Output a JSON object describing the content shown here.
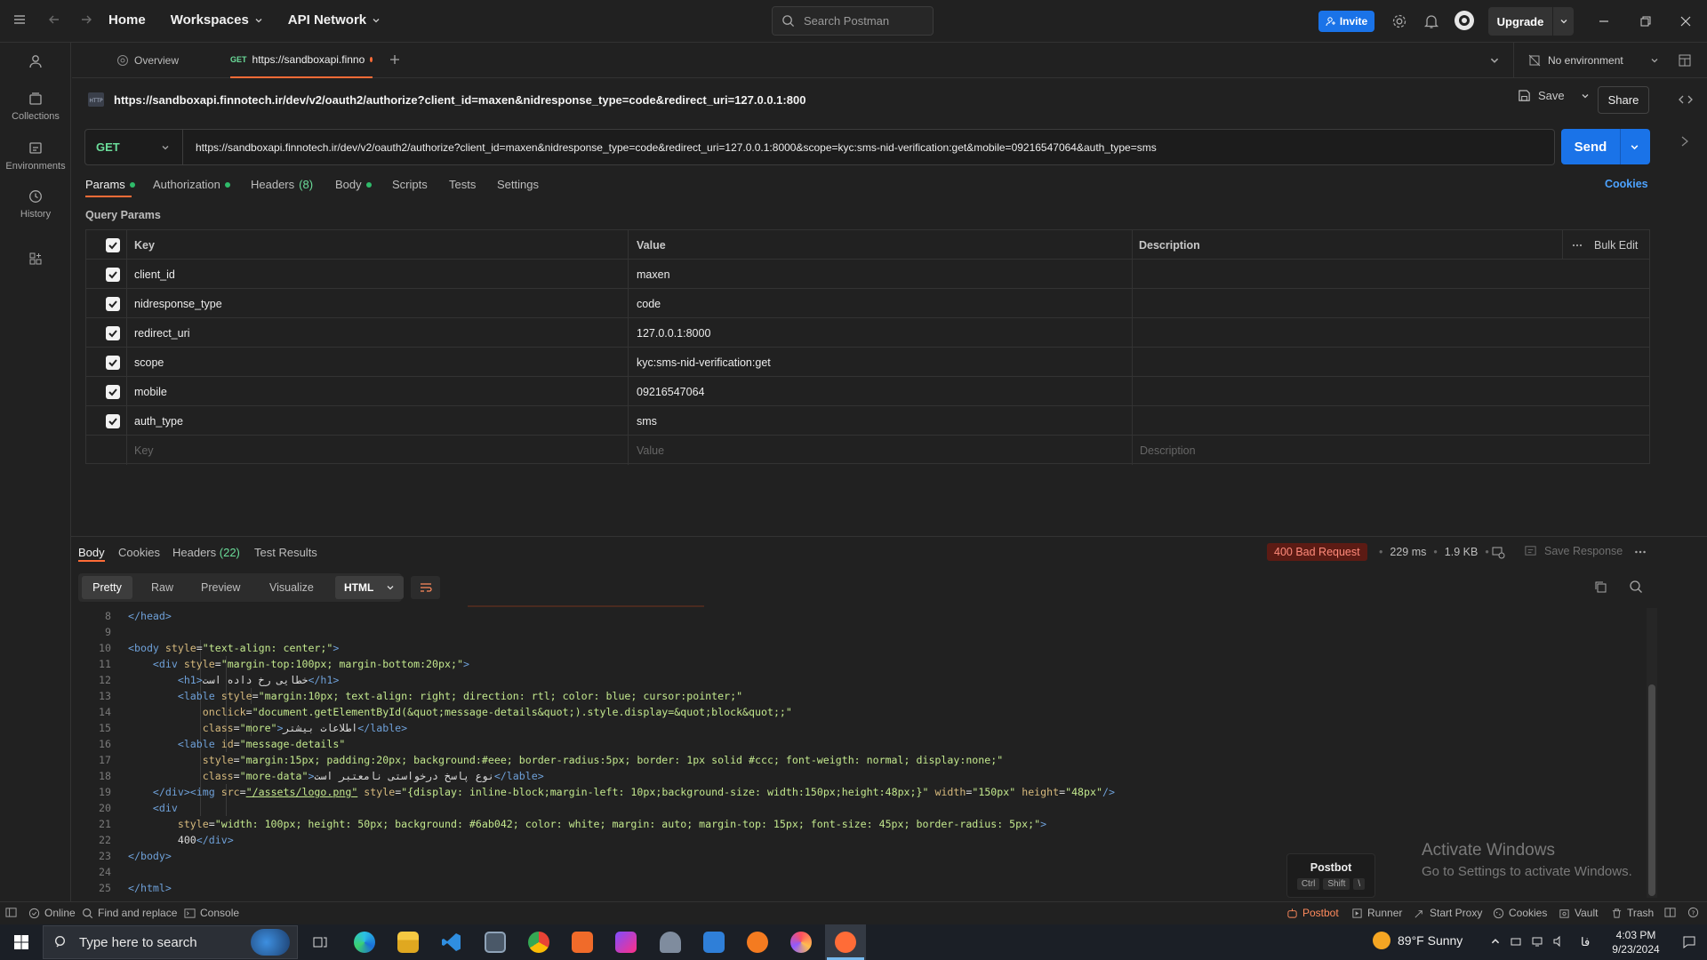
{
  "topbar": {
    "home": "Home",
    "workspaces": "Workspaces",
    "api_network": "API Network",
    "search_placeholder": "Search Postman",
    "invite": "Invite",
    "upgrade": "Upgrade"
  },
  "sidebar": {
    "items": [
      {
        "label": "Collections",
        "icon": "collections-icon"
      },
      {
        "label": "Environments",
        "icon": "environments-icon"
      },
      {
        "label": "History",
        "icon": "history-icon"
      }
    ]
  },
  "tabs": {
    "overview": "Overview",
    "active_method": "GET",
    "active_title": "https://sandboxapi.finno",
    "environment": "No environment"
  },
  "request": {
    "title": "https://sandboxapi.finnotech.ir/dev/v2/oauth2/authorize?client_id=maxen&nidresponse_type=code&redirect_uri=127.0.0.1:800",
    "save": "Save",
    "share": "Share",
    "method": "GET",
    "url": "https://sandboxapi.finnotech.ir/dev/v2/oauth2/authorize?client_id=maxen&nidresponse_type=code&redirect_uri=127.0.0.1:8000&scope=kyc:sms-nid-verification:get&mobile=09216547064&auth_type=sms",
    "send": "Send",
    "tabs": [
      "Params",
      "Authorization",
      "Headers",
      "(8)",
      "Body",
      "Scripts",
      "Tests",
      "Settings"
    ],
    "cookies": "Cookies",
    "query_params_label": "Query Params"
  },
  "params": {
    "headers": {
      "key": "Key",
      "value": "Value",
      "description": "Description",
      "bulk_edit": "Bulk Edit"
    },
    "rows": [
      {
        "key": "client_id",
        "value": "maxen"
      },
      {
        "key": "nidresponse_type",
        "value": "code"
      },
      {
        "key": "redirect_uri",
        "value": "127.0.0.1:8000"
      },
      {
        "key": "scope",
        "value": "kyc:sms-nid-verification:get"
      },
      {
        "key": "mobile",
        "value": "09216547064"
      },
      {
        "key": "auth_type",
        "value": "sms"
      }
    ],
    "placeholder": {
      "key": "Key",
      "value": "Value",
      "description": "Description"
    }
  },
  "response": {
    "tabs": {
      "body": "Body",
      "cookies": "Cookies",
      "headers": "Headers",
      "headers_count": "(22)",
      "test_results": "Test Results"
    },
    "status": "400 Bad Request",
    "time": "229 ms",
    "size": "1.9 KB",
    "save_response": "Save Response",
    "view_modes": [
      "Pretty",
      "Raw",
      "Preview",
      "Visualize"
    ],
    "format": "HTML",
    "postbot": {
      "title": "Postbot",
      "keys": [
        "Ctrl",
        "Shift",
        "\\"
      ]
    },
    "watermark": {
      "title": "Activate Windows",
      "subtitle": "Go to Settings to activate Windows."
    }
  },
  "statusbar": {
    "online": "Online",
    "find_replace": "Find and replace",
    "console": "Console",
    "postbot": "Postbot",
    "runner": "Runner",
    "start_proxy": "Start Proxy",
    "cookies": "Cookies",
    "vault": "Vault",
    "trash": "Trash"
  },
  "taskbar": {
    "search_placeholder": "Type here to search",
    "weather": "89°F  Sunny",
    "lang": "فا",
    "time": "4:03 PM",
    "date": "9/23/2024"
  },
  "code_lines": [
    "8",
    "9",
    "10",
    "11",
    "12",
    "13",
    "14",
    "15",
    "16",
    "17",
    "18",
    "19",
    "20",
    "21",
    "22",
    "23",
    "24",
    "25"
  ]
}
